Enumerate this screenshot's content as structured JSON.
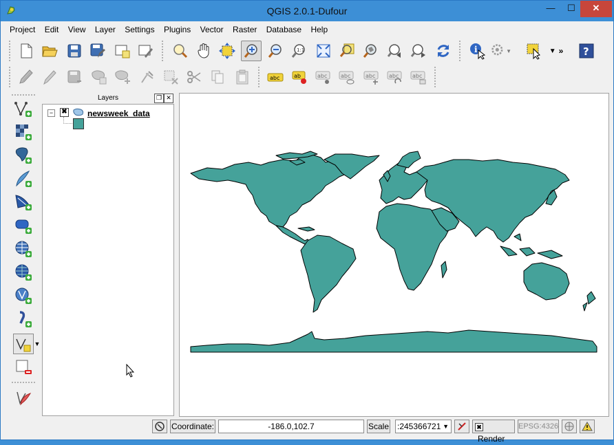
{
  "window": {
    "title": "QGIS 2.0.1-Dufour",
    "minimize": "—",
    "maximize": "☐",
    "close": "✕"
  },
  "menu": [
    "Project",
    "Edit",
    "View",
    "Layer",
    "Settings",
    "Plugins",
    "Vector",
    "Raster",
    "Database",
    "Help"
  ],
  "toolbar_icons": {
    "row1": [
      "new-project-icon",
      "open-project-icon",
      "save-project-icon",
      "save-as-icon",
      "new-print-composer-icon",
      "composer-manager-icon",
      "touch-zoom-icon",
      "pan-icon",
      "pan-to-selection-icon",
      "zoom-in-icon",
      "zoom-out-icon",
      "zoom-actual-size-icon",
      "zoom-full-icon",
      "zoom-to-selection-icon",
      "zoom-to-layer-icon",
      "zoom-last-icon",
      "zoom-next-icon",
      "refresh-icon",
      "identify-icon",
      "run-feature-action-icon",
      "select-features-icon",
      "more-tools-icon",
      "help-icon"
    ],
    "row2": [
      "current-edits-icon",
      "toggle-editing-icon",
      "save-layer-edits-icon",
      "add-feature-icon",
      "move-feature-icon",
      "node-tool-icon",
      "delete-selected-icon",
      "cut-features-icon",
      "copy-features-icon",
      "paste-features-icon",
      "label-icon",
      "layer-labeling-icon",
      "pin-labels-icon",
      "show-hide-labels-icon",
      "move-label-icon",
      "rotate-label-icon",
      "change-label-icon"
    ],
    "left": [
      "add-vector-layer-icon",
      "add-raster-layer-icon",
      "add-postgis-layer-icon",
      "add-spatialite-layer-icon",
      "add-mssql-layer-icon",
      "add-oracle-layer-icon",
      "add-wms-layer-icon",
      "add-wcs-layer-icon",
      "add-wfs-layer-icon",
      "add-delimited-text-icon",
      "new-shapefile-icon",
      "remove-layer-icon",
      "new-spatialite-layer-icon"
    ]
  },
  "layers_panel": {
    "title": "Layers",
    "float_btn": "❐",
    "close_btn": "✕",
    "expand": "−",
    "checked": "✖",
    "layer_name": "newsweek_data",
    "fill_color": "#45a29a"
  },
  "map": {
    "fill_color": "#45a29a",
    "stroke_color": "#000000"
  },
  "status": {
    "coordinate_label": "Coordinate:",
    "coordinate_value": "-186.0,102.7",
    "scale_label": "Scale",
    "scale_value": ":245366721",
    "render_label": "Render",
    "render_checked": "✖",
    "crs": "EPSG:4326"
  }
}
